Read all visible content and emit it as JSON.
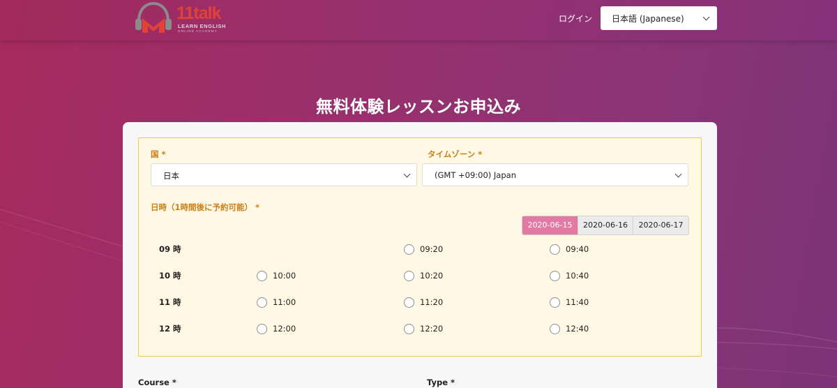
{
  "header": {
    "logo": {
      "word": "11talk",
      "line1": "LEARN ENGLISH",
      "line2": "ONLINE ACADEMY"
    },
    "login_label": "ログイン",
    "language_select": {
      "selected": "日本語 (Japanese)"
    }
  },
  "page_title": "無料体験レッスンお申込み",
  "form": {
    "country": {
      "label": "国 *",
      "selected": "日本"
    },
    "timezone": {
      "label": "タイムゾーン *",
      "selected": "(GMT +09:00) Japan"
    },
    "datetime_label": "日時（1時間後に予約可能） *",
    "dates": [
      {
        "label": "2020-06-15",
        "active": true
      },
      {
        "label": "2020-06-16",
        "active": false
      },
      {
        "label": "2020-06-17",
        "active": false
      }
    ],
    "hours": [
      {
        "label": "09 時",
        "slots": [
          null,
          "09:20",
          "09:40"
        ]
      },
      {
        "label": "10 時",
        "slots": [
          "10:00",
          "10:20",
          "10:40"
        ]
      },
      {
        "label": "11 時",
        "slots": [
          "11:00",
          "11:20",
          "11:40"
        ]
      },
      {
        "label": "12 時",
        "slots": [
          "12:00",
          "12:20",
          "12:40"
        ]
      }
    ],
    "course_label": "Course *",
    "type_label": "Type *"
  },
  "colors": {
    "accent_pink": "#e37aa3",
    "label_orange": "#cc7f16",
    "panel_bg": "#fff8e4",
    "logo_red": "#e2413a"
  }
}
